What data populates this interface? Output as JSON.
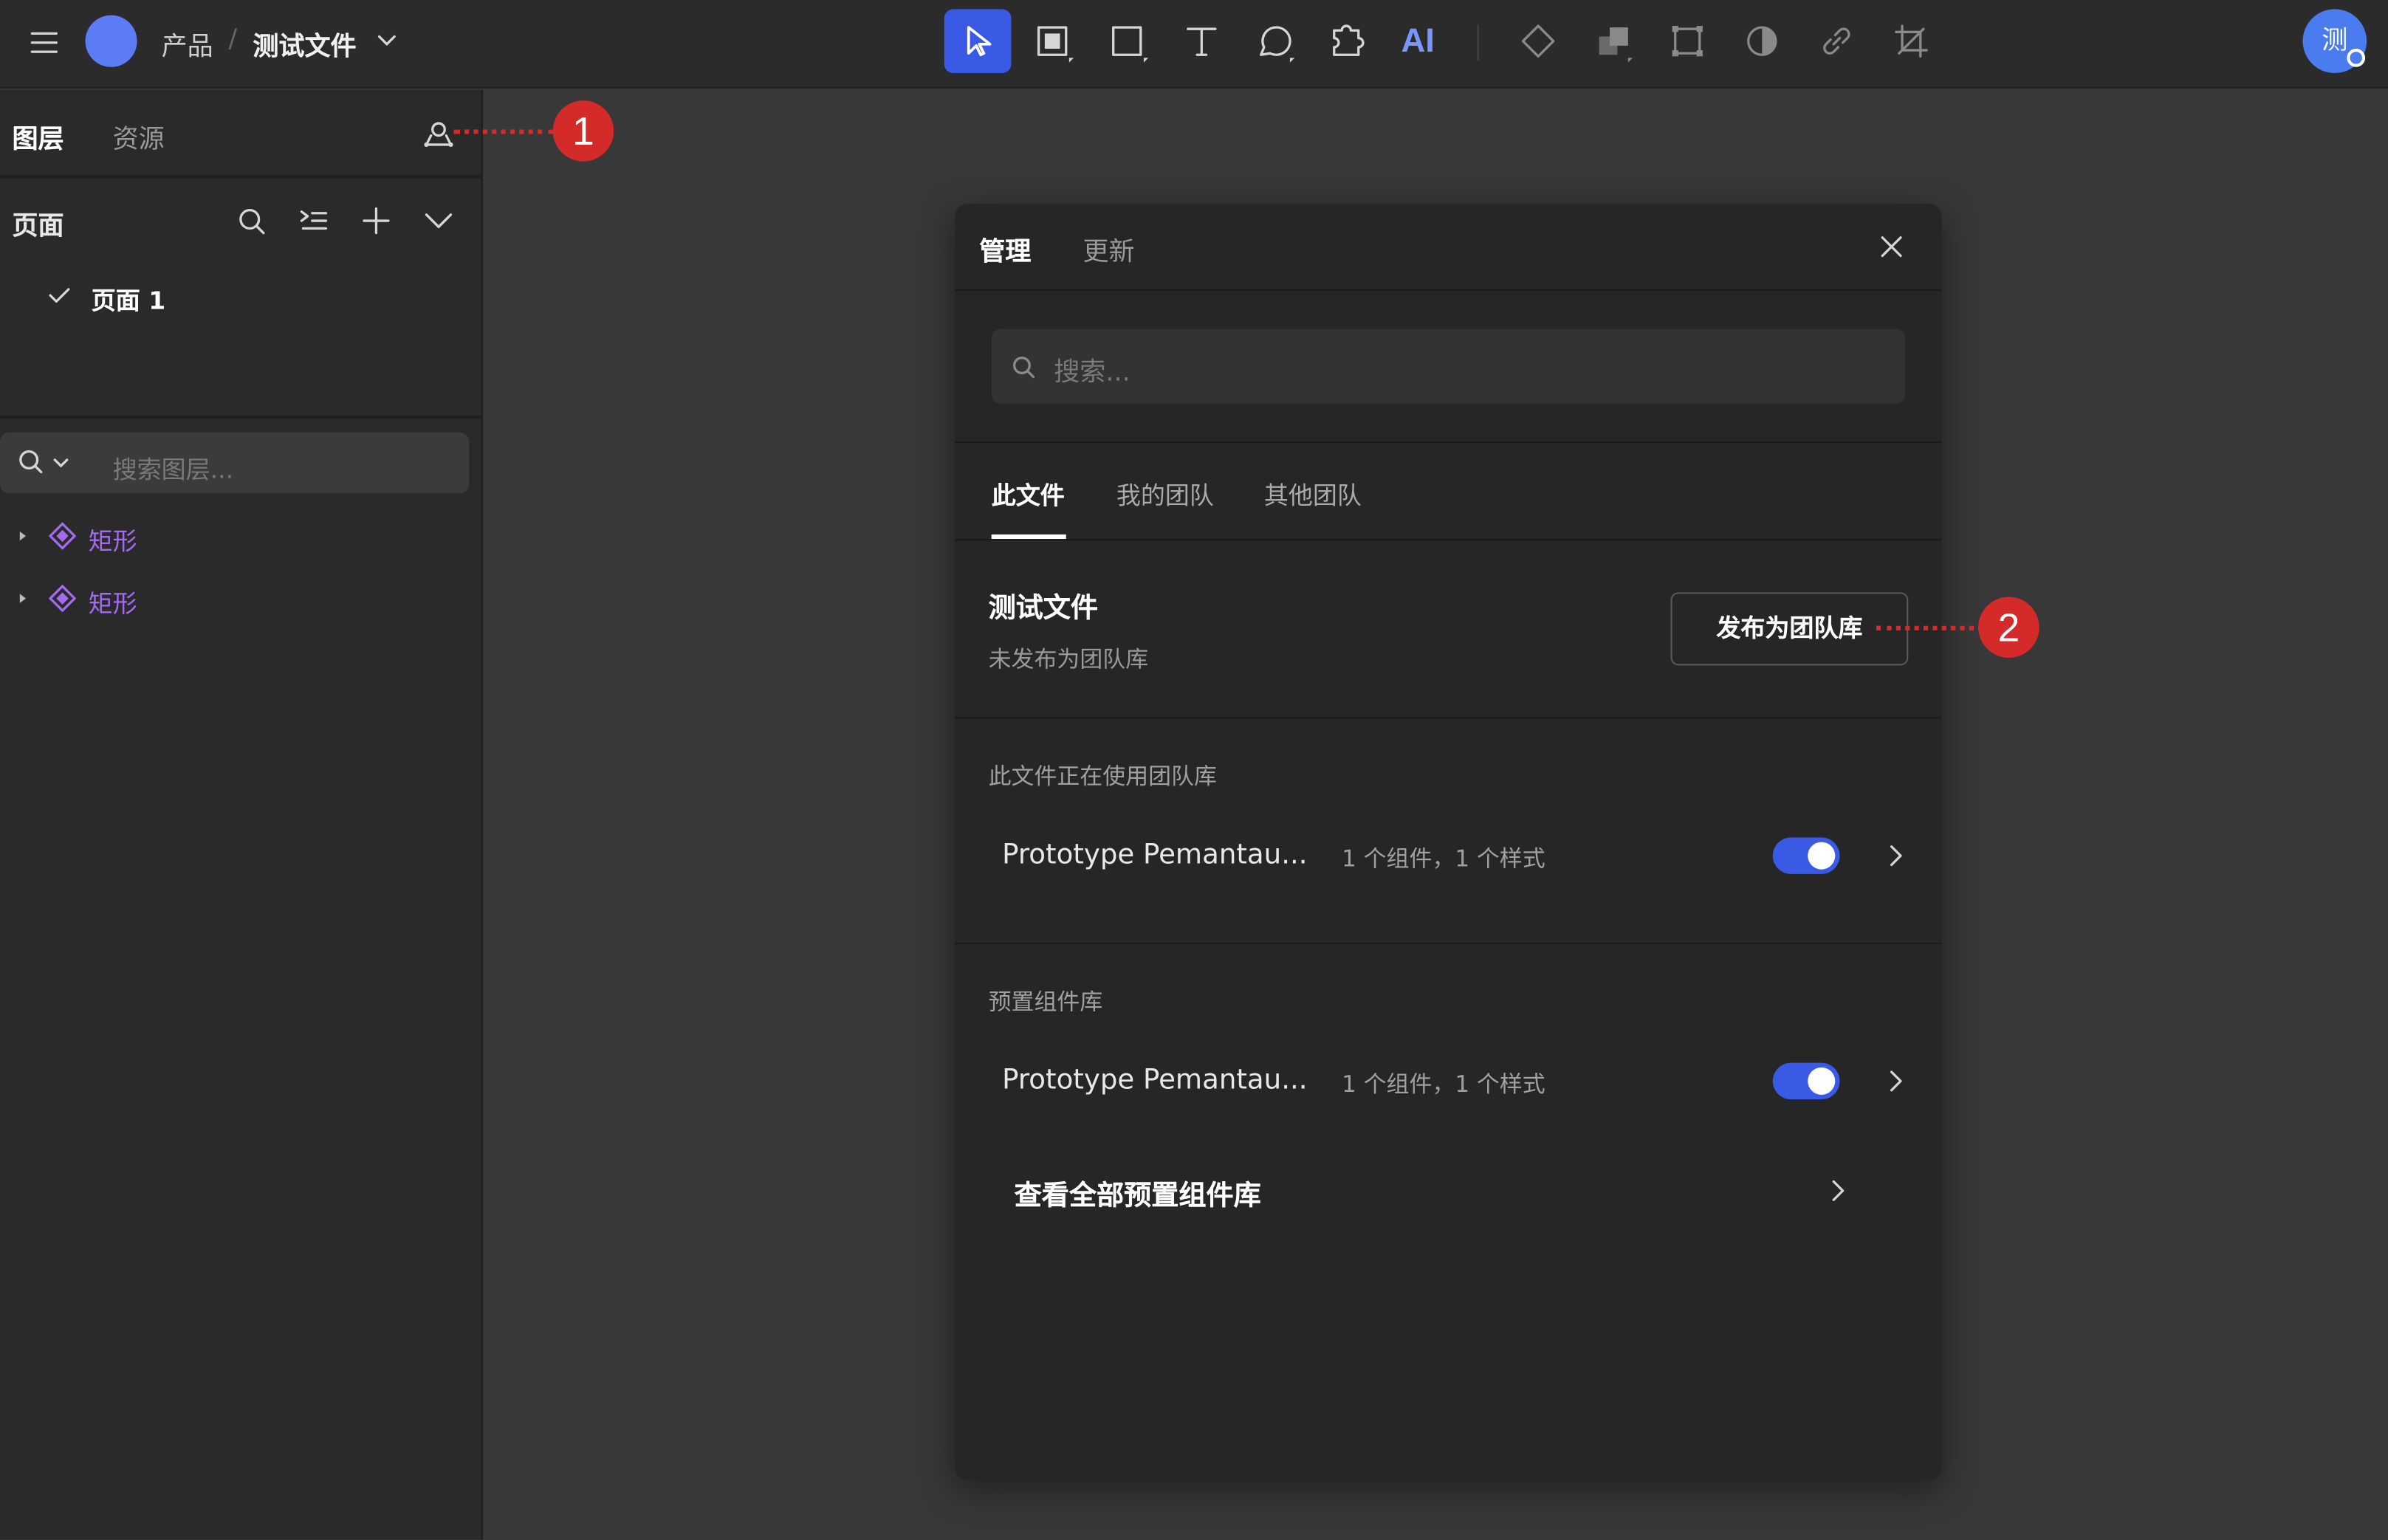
{
  "topbar": {
    "breadcrumb_parent": "产品",
    "breadcrumb_sep": "/",
    "file_name": "测试文件",
    "ai_label": "AI",
    "avatar_initial": "测"
  },
  "left_panel": {
    "tabs": [
      "图层",
      "资源"
    ],
    "pages_title": "页面",
    "pages": [
      "页面 1"
    ],
    "layer_search_placeholder": "搜索图层...",
    "layers": [
      "矩形",
      "矩形"
    ]
  },
  "dialog": {
    "tabs": [
      "管理",
      "更新"
    ],
    "search_placeholder": "搜索...",
    "sub_tabs": [
      "此文件",
      "我的团队",
      "其他团队"
    ],
    "file_title": "测试文件",
    "file_status": "未发布为团队库",
    "publish_button": "发布为团队库",
    "using_section_title": "此文件正在使用团队库",
    "using_libraries": [
      {
        "name": "Prototype Pemantau...",
        "meta": "1 个组件，1 个样式",
        "enabled": true
      }
    ],
    "preset_section_title": "预置组件库",
    "preset_libraries": [
      {
        "name": "Prototype Pemantau...",
        "meta": "1 个组件，1 个样式",
        "enabled": true
      }
    ],
    "view_all_label": "查看全部预置组件库"
  },
  "callouts": [
    "1",
    "2"
  ],
  "colors": {
    "accent": "#3a5ae6",
    "callout": "#d42a2a",
    "layer_component": "#a26bf0"
  }
}
